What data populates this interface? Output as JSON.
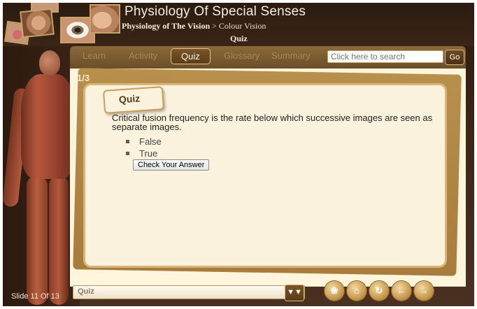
{
  "header": {
    "app_title": "Physiology Of Special Senses",
    "breadcrumb_main": "Physiology of The Vision",
    "breadcrumb_sep": " > ",
    "breadcrumb_sub": "Colour Vision",
    "section": "Quiz"
  },
  "nav": {
    "tabs": [
      {
        "label": "Learn"
      },
      {
        "label": "Activity"
      },
      {
        "label": "Quiz"
      },
      {
        "label": "Glossary"
      },
      {
        "label": "Summary"
      }
    ],
    "active_tab": "Quiz",
    "search_placeholder": "Click here to search",
    "go_label": "Go"
  },
  "quiz": {
    "counter": "1/3",
    "tab_label": "Quiz",
    "question": "Critical fusion frequency is the rate below which successive images are seen as separate images.",
    "options": [
      "False",
      "True"
    ],
    "check_label": "Check Your Answer"
  },
  "footer": {
    "slide_label": "Slide 11 Of 13",
    "select_value": "Quiz",
    "controls": [
      "glossary-icon",
      "home-icon",
      "refresh-icon",
      "back-icon",
      "next-icon"
    ]
  },
  "colors": {
    "frame": "#3a2516",
    "accent": "#c89a4e",
    "card": "#fbf2de"
  }
}
